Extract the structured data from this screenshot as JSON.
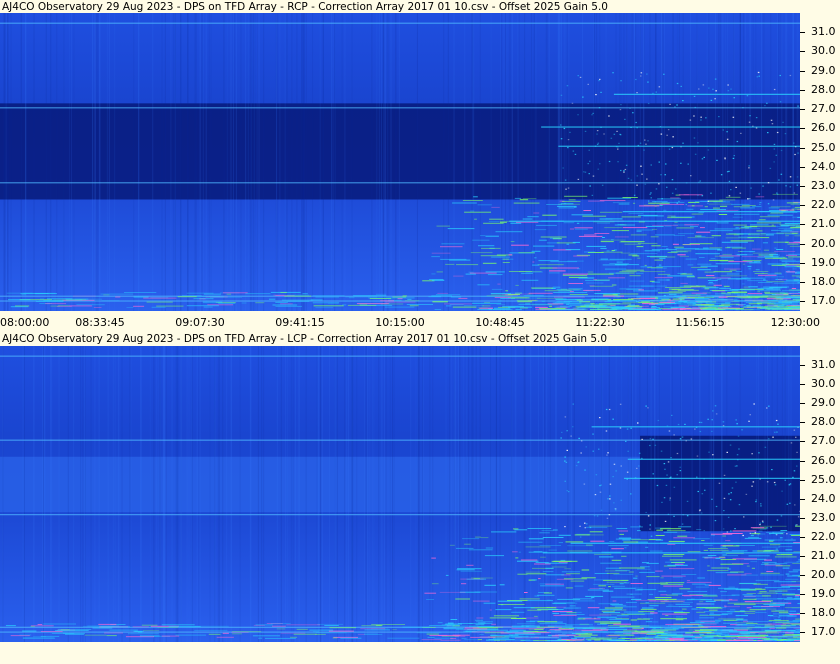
{
  "panels": [
    {
      "id": "rcp",
      "title": "AJ4CO Observatory 29 Aug 2023  -  DPS on TFD Array  -  RCP  -  Correction Array 2017 01 10.csv  -  Offset 2025  Gain 5.0",
      "dark_start_fraction": 0.0
    },
    {
      "id": "lcp",
      "title": "AJ4CO Observatory 29 Aug 2023  -  DPS on TFD Array  -  LCP  -  Correction Array 2017 01 10.csv  -  Offset 2025  Gain 5.0",
      "dark_start_fraction": 0.8
    }
  ],
  "chart_data": {
    "type": "heatmap",
    "x_tick_labels": [
      "08:00:00",
      "08:33:45",
      "09:07:30",
      "09:41:15",
      "10:15:00",
      "10:48:45",
      "11:22:30",
      "11:56:15",
      "12:30:00"
    ],
    "y_tick_labels": [
      "31.0",
      "30.0",
      "29.0",
      "28.0",
      "27.0",
      "26.0",
      "25.0",
      "24.0",
      "23.0",
      "22.0",
      "21.0",
      "20.0",
      "19.0",
      "18.0",
      "17.0"
    ],
    "y_values_mhz": [
      31,
      30,
      29,
      28,
      27,
      26,
      25,
      24,
      23,
      22,
      21,
      20,
      19,
      18,
      17
    ],
    "x_range": [
      "08:00:00",
      "12:30:00"
    ],
    "y_range_mhz": [
      16.5,
      32.0
    ],
    "colors": {
      "background": "#1a3fd6",
      "dark_band": "#071a7a",
      "hot_low": "#2ad1ff",
      "hot_mid": "#7dff6a",
      "hot_high": "#ff6ad8",
      "panel_bg": "#fffce6"
    }
  }
}
